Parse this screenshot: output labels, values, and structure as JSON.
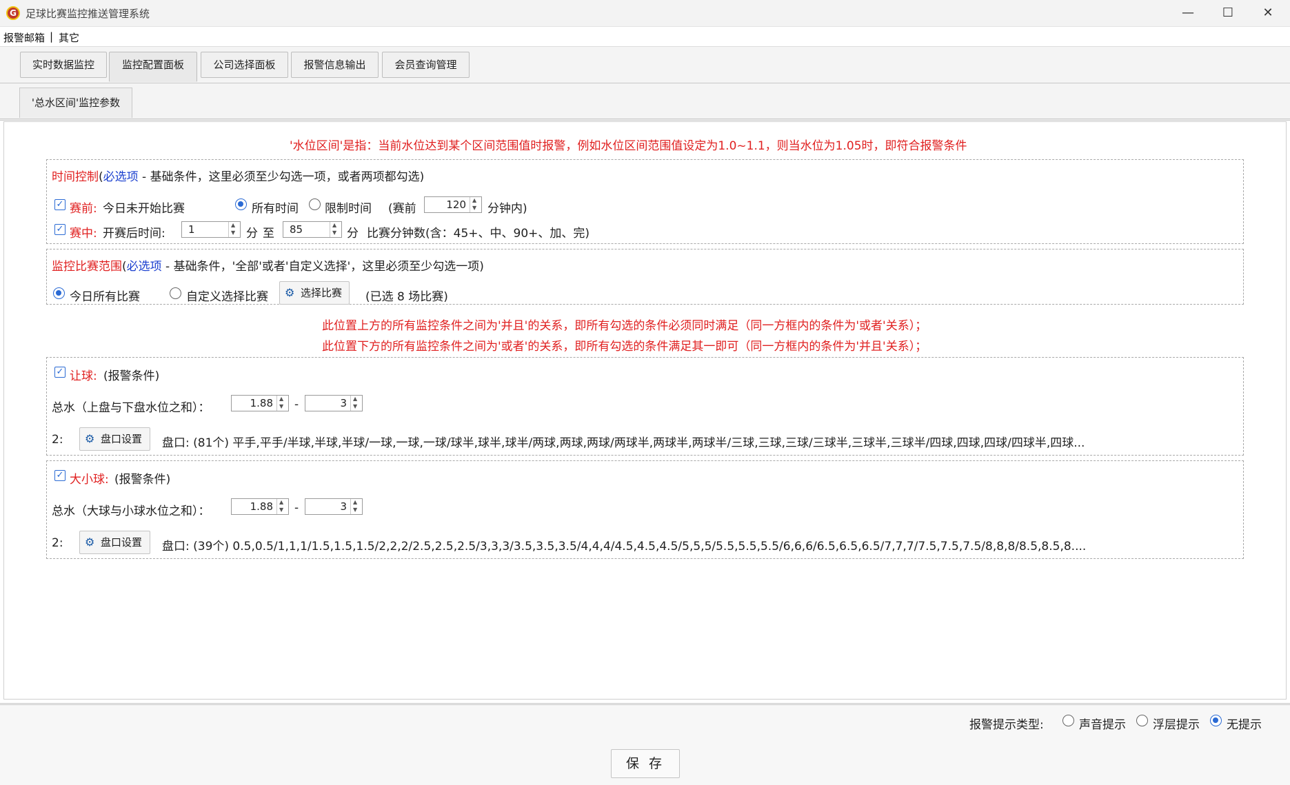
{
  "window": {
    "title": "足球比赛监控推送管理系统",
    "icon": "app-logo-icon",
    "controls": [
      "minimize-icon",
      "maximize-icon",
      "close-icon"
    ]
  },
  "menu": {
    "items": [
      "报警邮箱",
      "其它"
    ],
    "separator": "|"
  },
  "tabs": [
    {
      "label": "实时数据监控"
    },
    {
      "label": "监控配置面板",
      "active": true
    },
    {
      "label": "公司选择面板"
    },
    {
      "label": "报警信息输出"
    },
    {
      "label": "会员查询管理"
    }
  ],
  "subtab": {
    "label": "'总水区间'监控参数"
  },
  "notice_top": "'水位区间'是指：当前水位达到某个区间范围值时报警，例如水位区间范围值设定为1.0~1.1，则当水位为1.05时，即符合报警条件",
  "time_control": {
    "title": "时间控制",
    "paren_open": "(",
    "required": "必选项",
    "desc": "- 基础条件，这里必须至少勾选一项，或者两项都勾选)",
    "prematch": {
      "label": "赛前:",
      "desc": "今日未开始比赛",
      "all_time": "所有时间",
      "limit_time": "限制时间",
      "before_prefix": "(赛前",
      "before_value": "120",
      "before_suffix": "分钟内)"
    },
    "inplay": {
      "label": "赛中:",
      "desc": "开赛后时间:",
      "from_value": "1",
      "unit1": "分",
      "to": "至",
      "to_value": "85",
      "unit2": "分",
      "note": "比赛分钟数(含：45+、中、90+、加、完)"
    }
  },
  "scope": {
    "title": "监控比赛范围",
    "paren_open": "(",
    "required": "必选项",
    "desc": "- 基础条件，'全部'或者'自定义选择'，这里必须至少勾选一项)",
    "all_today": "今日所有比赛",
    "custom": "自定义选择比赛",
    "select_button": "选择比赛",
    "selected_info": "(已选  8  场比赛)"
  },
  "notice_mid": [
    "此位置上方的所有监控条件之间为'并且'的关系，即所有勾选的条件必须同时满足（同一方框内的条件为'或者'关系）；",
    "此位置下方的所有监控条件之间为'或者'的关系，即所有勾选的条件满足其一即可（同一方框内的条件为'并且'关系）；"
  ],
  "handicap": {
    "label": "让球:",
    "cond": "(报警条件)",
    "total_label": "总水（上盘与下盘水位之和）：",
    "min": "1.88",
    "dash": "-",
    "max": "3",
    "idx": "2:",
    "btn": "盘口设置",
    "lines": "盘口: (81个) 平手,平手/半球,半球,半球/一球,一球,一球/球半,球半,球半/两球,两球,两球/两球半,两球半,两球半/三球,三球,三球/三球半,三球半,三球半/四球,四球,四球/四球半,四球..."
  },
  "overunder": {
    "label": "大小球:",
    "cond": "(报警条件)",
    "total_label": "总水（大球与小球水位之和）：",
    "min": "1.88",
    "dash": "-",
    "max": "3",
    "idx": "2:",
    "btn": "盘口设置",
    "lines": "盘口: (39个) 0.5,0.5/1,1,1/1.5,1.5,1.5/2,2,2/2.5,2.5,2.5/3,3,3/3.5,3.5,3.5/4,4,4/4.5,4.5,4.5/5,5,5/5.5,5.5,5.5/6,6,6/6.5,6.5,6.5/7,7,7/7.5,7.5,7.5/8,8,8/8.5,8.5,8...."
  },
  "alert_type": {
    "label": "报警提示类型:",
    "options": [
      "声音提示",
      "浮层提示",
      "无提示"
    ],
    "selected": "无提示"
  },
  "save": "保 存"
}
